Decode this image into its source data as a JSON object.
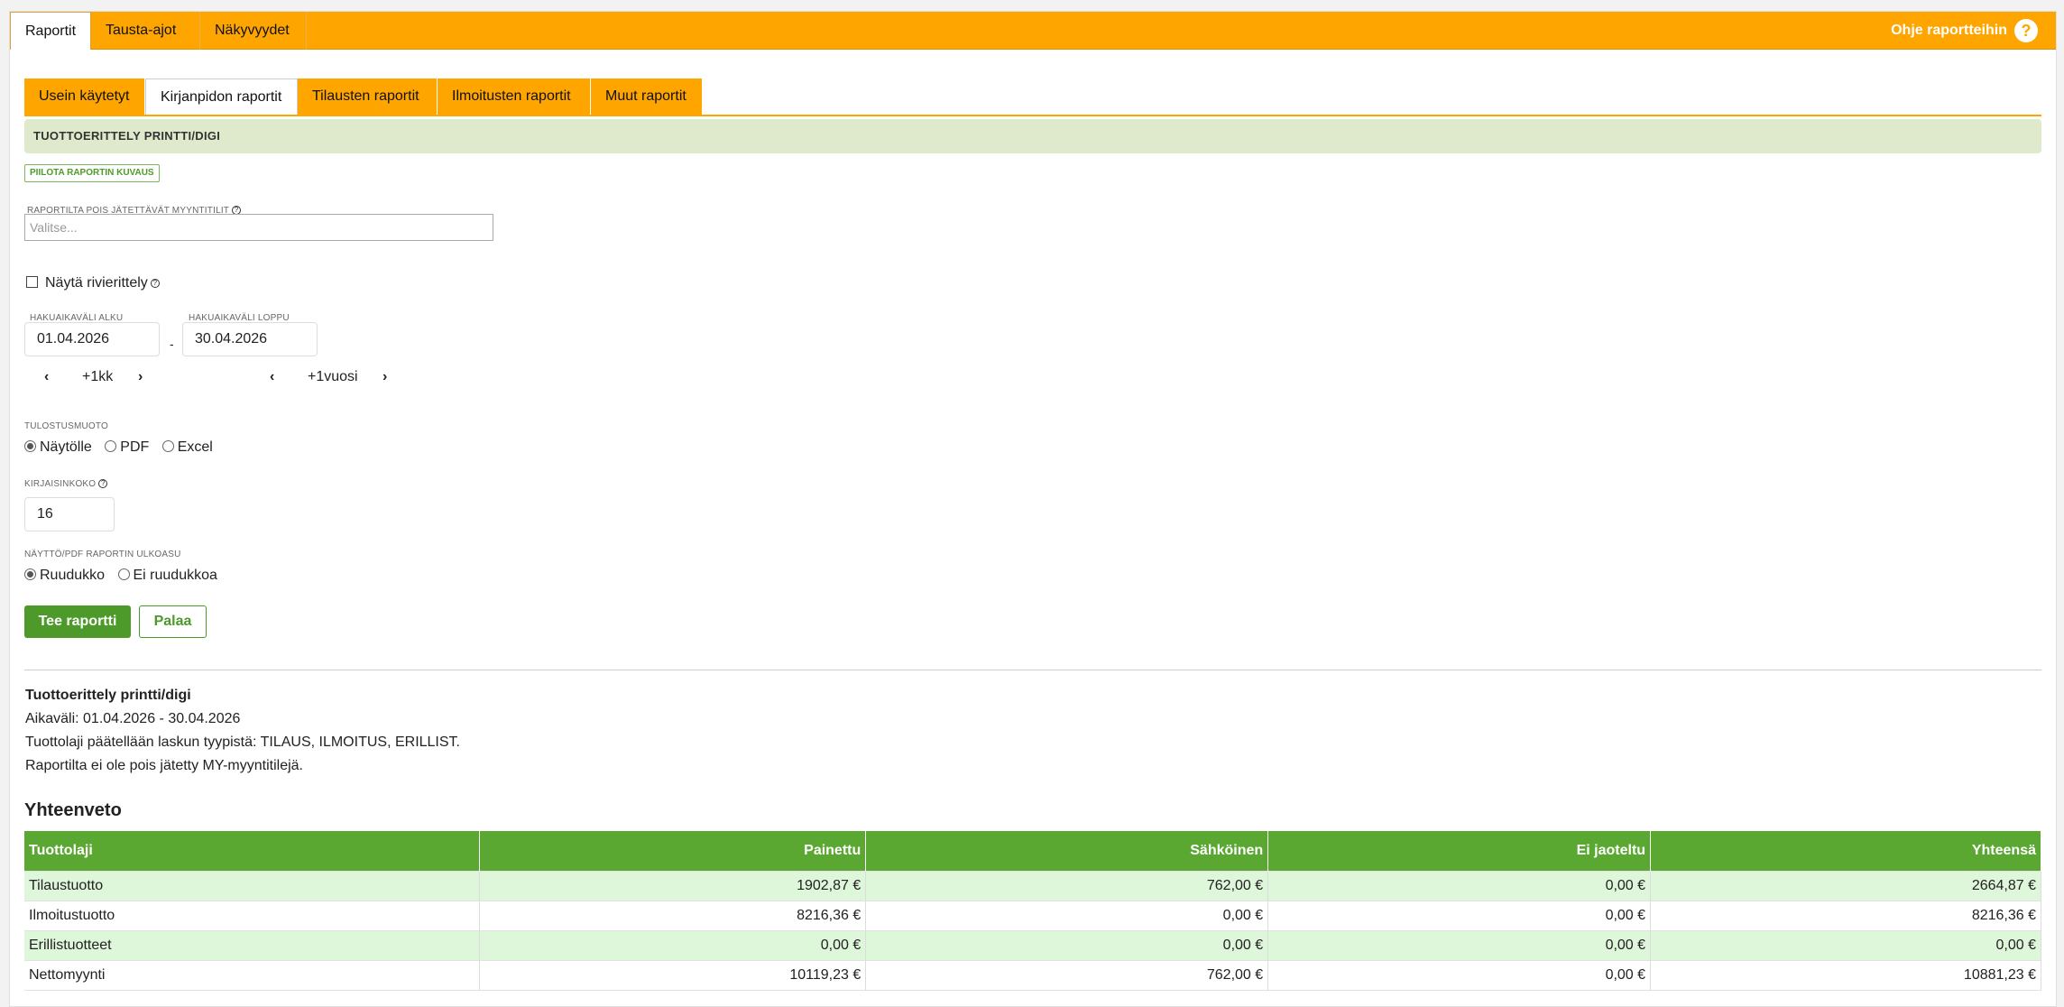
{
  "topnav": {
    "tabs": [
      "Raportit",
      "Tausta-ajot",
      "Näkyvyydet"
    ],
    "help_label": "Ohje raportteihin",
    "help_icon": "?"
  },
  "subtabs": [
    "Usein käytetyt",
    "Kirjanpidon raportit",
    "Tilausten raportit",
    "Ilmoitusten raportit",
    "Muut raportit"
  ],
  "report": {
    "title": "TUOTTOERITTELY PRINTTI/DIGI",
    "hide_desc_label": "PIILOTA RAPORTIN KUVAUS"
  },
  "form": {
    "excluded_accounts_label": "RAPORTILTA POIS JÄTETTÄVÄT MYYNTITILIT",
    "excluded_accounts_placeholder": "Valitse...",
    "show_rows_label": "Näytä rivierittely",
    "start_label": "HAKUAIKAVÄLI ALKU",
    "start_value": "01.04.2026",
    "end_label": "HAKUAIKAVÄLI LOPPU",
    "end_value": "30.04.2026",
    "dash": "-",
    "month_step": "+1kk",
    "year_step": "+1vuosi",
    "output_label": "TULOSTUSMUOTO",
    "output_options": [
      "Näytölle",
      "PDF",
      "Excel"
    ],
    "font_size_label": "KIRJAISINKOKO",
    "font_size_value": "16",
    "layout_label": "NÄYTTÖ/PDF RAPORTIN ULKOASU",
    "layout_options": [
      "Ruudukko",
      "Ei ruudukkoa"
    ],
    "submit_label": "Tee raportti",
    "back_label": "Palaa"
  },
  "result": {
    "title": "Tuottoerittely printti/digi",
    "lines": [
      "Aikaväli: 01.04.2026 - 30.04.2026",
      "Tuottolaji päätellään laskun tyypistä: TILAUS, ILMOITUS, ERILLIST.",
      "Raportilta ei ole pois jätetty MY-myyntitilejä."
    ],
    "summary_title": "Yhteenveto",
    "columns": [
      "Tuottolaji",
      "Painettu",
      "Sähköinen",
      "Ei jaoteltu",
      "Yhteensä"
    ],
    "rows": [
      [
        "Tilaustuotto",
        "1902,87 €",
        "762,00 €",
        "0,00 €",
        "2664,87 €"
      ],
      [
        "Ilmoitustuotto",
        "8216,36 €",
        "0,00 €",
        "0,00 €",
        "8216,36 €"
      ],
      [
        "Erillistuotteet",
        "0,00 €",
        "0,00 €",
        "0,00 €",
        "0,00 €"
      ],
      [
        "Nettomyynti",
        "10119,23 €",
        "762,00 €",
        "0,00 €",
        "10881,23 €"
      ]
    ]
  },
  "colors": {
    "accent_orange": "#ffa500",
    "primary_green": "#4d9a2a",
    "table_header_green": "#5aa832",
    "row_highlight": "#def6d9"
  }
}
